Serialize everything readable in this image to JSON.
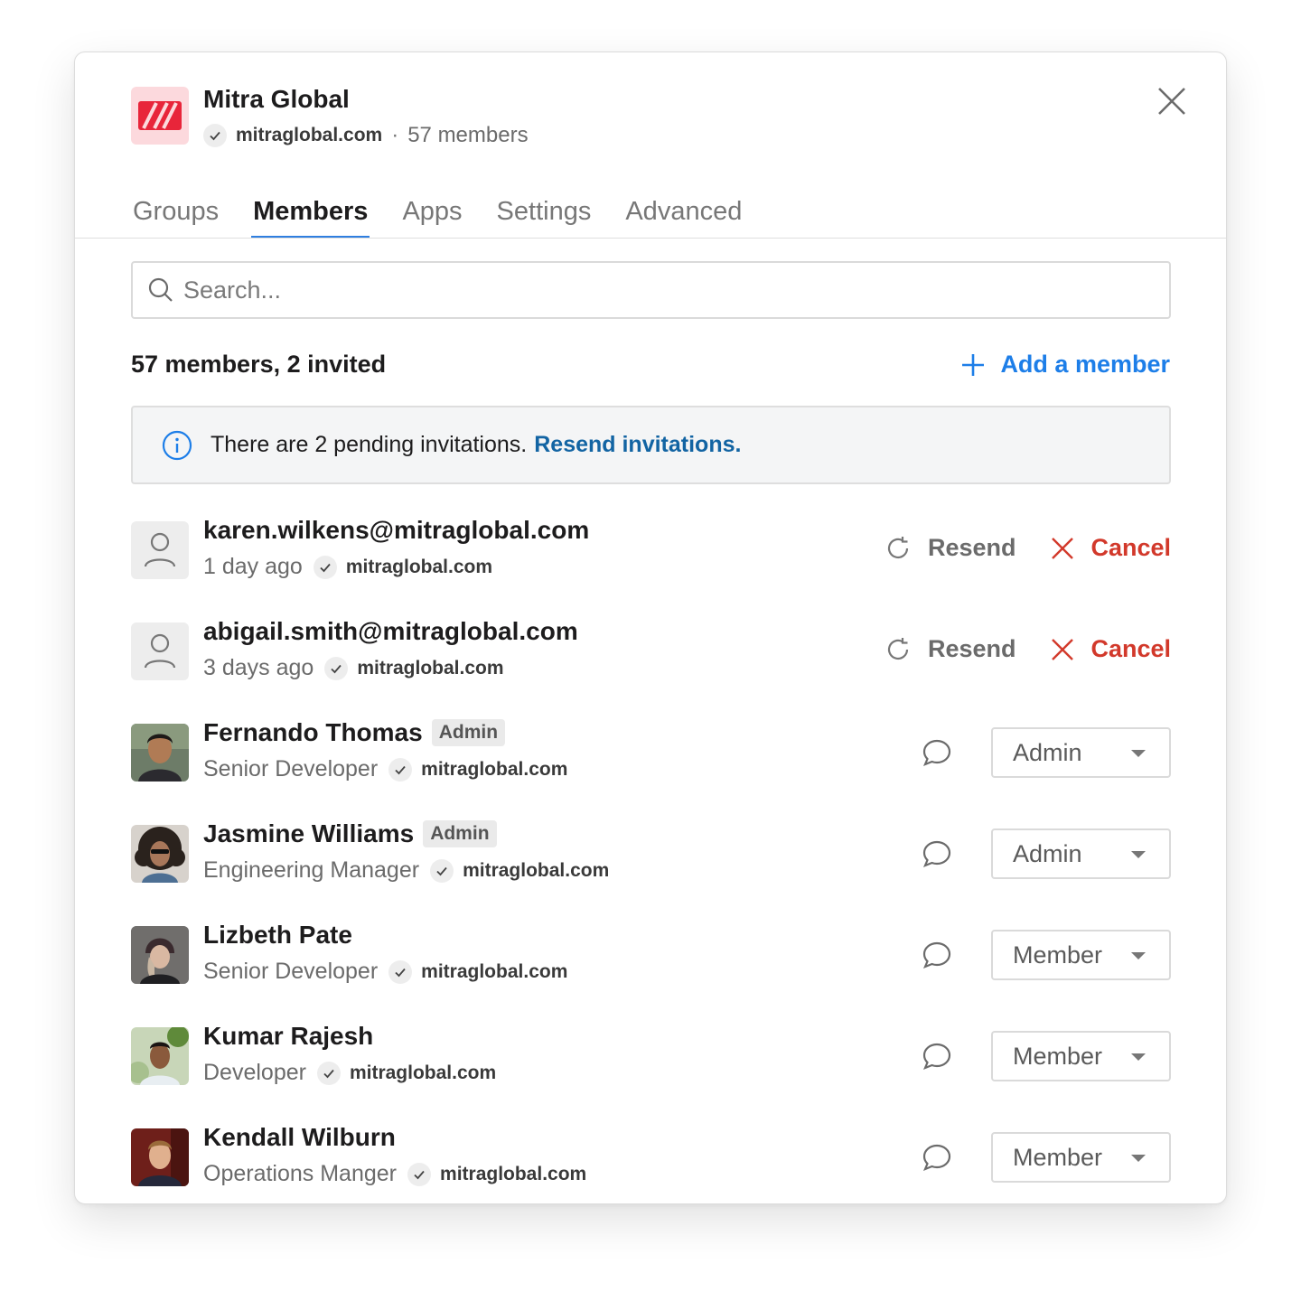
{
  "org": {
    "name": "Mitra Global",
    "domain": "mitraglobal.com",
    "separator": "·",
    "member_count": "57 members"
  },
  "tabs": [
    {
      "label": "Groups",
      "active": false
    },
    {
      "label": "Members",
      "active": true
    },
    {
      "label": "Apps",
      "active": false
    },
    {
      "label": "Settings",
      "active": false
    },
    {
      "label": "Advanced",
      "active": false
    }
  ],
  "search": {
    "placeholder": "Search..."
  },
  "summary": {
    "title": "57 members, 2 invited",
    "add_label": "Add a member"
  },
  "banner": {
    "text": "There are 2 pending invitations.",
    "link": "Resend invitations."
  },
  "invites": [
    {
      "email": "karen.wilkens@mitraglobal.com",
      "time": "1 day ago",
      "domain": "mitraglobal.com",
      "resend_label": "Resend",
      "cancel_label": "Cancel"
    },
    {
      "email": "abigail.smith@mitraglobal.com",
      "time": "3 days ago",
      "domain": "mitraglobal.com",
      "resend_label": "Resend",
      "cancel_label": "Cancel"
    }
  ],
  "members": [
    {
      "name": "Fernando Thomas",
      "tag": "Admin",
      "title": "Senior Developer",
      "domain": "mitraglobal.com",
      "role": "Admin"
    },
    {
      "name": "Jasmine Williams",
      "tag": "Admin",
      "title": "Engineering Manager",
      "domain": "mitraglobal.com",
      "role": "Admin"
    },
    {
      "name": "Lizbeth Pate",
      "tag": "",
      "title": "Senior Developer",
      "domain": "mitraglobal.com",
      "role": "Member"
    },
    {
      "name": "Kumar Rajesh",
      "tag": "",
      "title": "Developer",
      "domain": "mitraglobal.com",
      "role": "Member"
    },
    {
      "name": "Kendall Wilburn",
      "tag": "",
      "title": "Operations Manger",
      "domain": "mitraglobal.com",
      "role": "Member"
    }
  ],
  "colors": {
    "accent": "#2f7fe0",
    "link": "#1264a3",
    "danger": "#d2392b",
    "logo_red": "#e8253a",
    "logo_bg": "#fcd9dd"
  }
}
